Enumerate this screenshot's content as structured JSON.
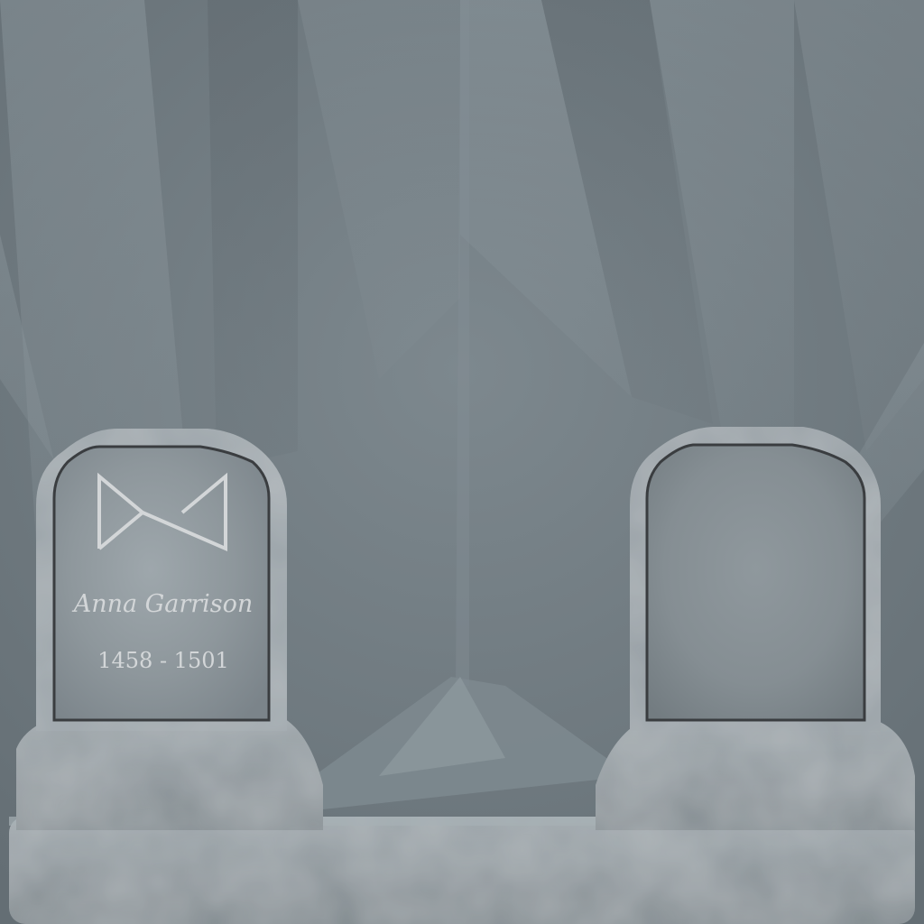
{
  "scene": {
    "name": "Graveyard headstones",
    "colors": {
      "sky_light": "#8a959b",
      "sky_mid": "#747f86",
      "sky_dark": "#5f686e",
      "stone_light": "#a9b1b6",
      "stone_mid": "#8f989d",
      "stone_dark": "#6f787d",
      "outline": "#3a3d40",
      "engraving": "#d3d6d8"
    }
  },
  "headstones": [
    {
      "name_text": "Anna Garrison",
      "dates_text": "1458 - 1501",
      "emblem_icon": "bowtie-rune-icon"
    },
    {
      "name_text": "",
      "dates_text": "",
      "emblem_icon": ""
    }
  ]
}
